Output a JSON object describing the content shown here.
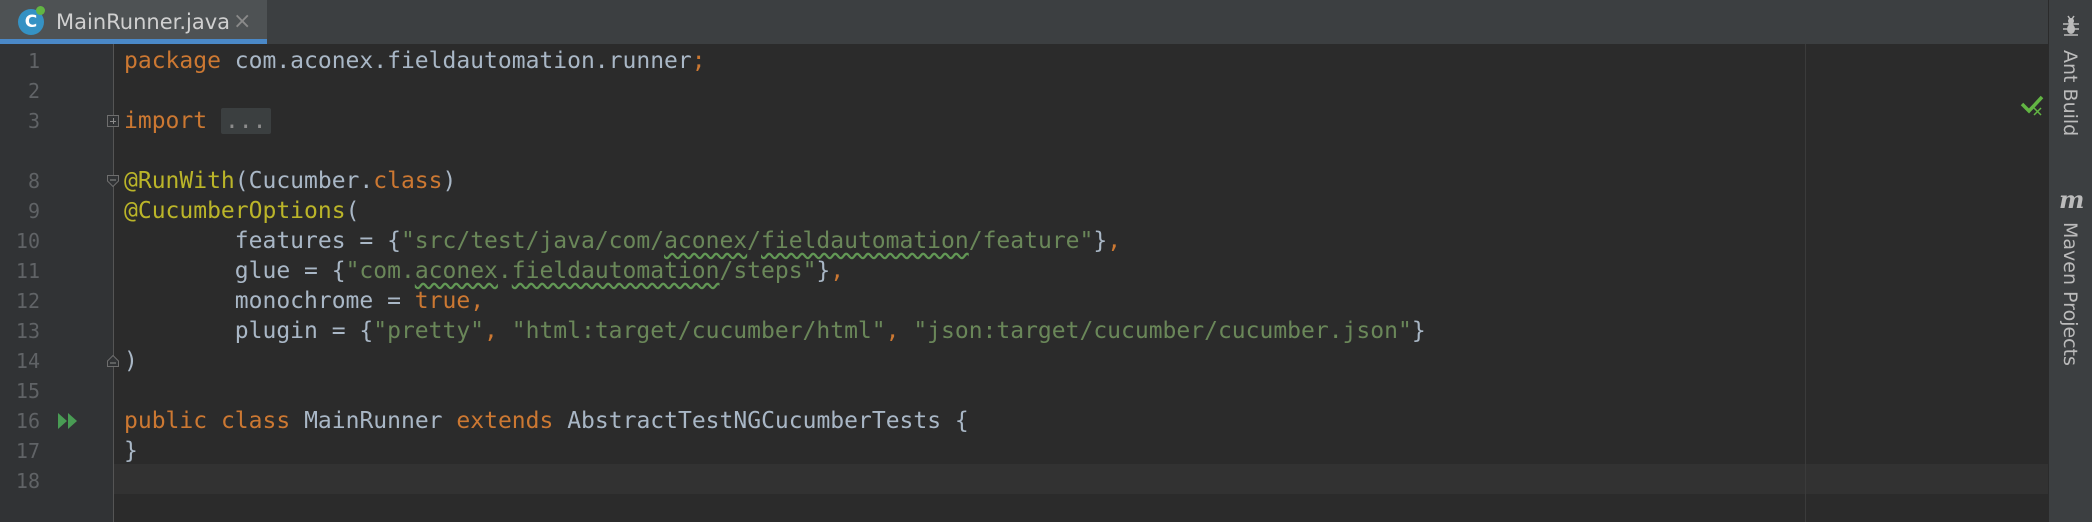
{
  "tab": {
    "icon_letter": "C",
    "title": "MainRunner.java",
    "close": "×"
  },
  "editor": {
    "line_numbers": [
      "1",
      "2",
      "3",
      "8",
      "9",
      "10",
      "11",
      "12",
      "13",
      "14",
      "15",
      "16",
      "17",
      "18"
    ],
    "lines": {
      "l1": {
        "kw": "package",
        "rest": " com.aconex.fieldautomation.runner",
        "semi": ";"
      },
      "l3": {
        "kw": "import",
        "folded": "..."
      },
      "l8": {
        "ann": "@RunWith",
        "open": "(Cucumber.",
        "kw": "class",
        "close": ")"
      },
      "l9": {
        "ann": "@CucumberOptions",
        "open": "("
      },
      "l10": {
        "name": "        features = {",
        "str_a": "\"src/test/java/com/",
        "str_b": "aconex",
        "str_c": "/",
        "str_d": "fieldautomation",
        "str_e": "/feature\"",
        "close": "}",
        "comma": ","
      },
      "l11": {
        "name": "        glue = {",
        "str_a": "\"com.",
        "str_b": "aconex",
        "str_c": ".",
        "str_d": "fieldautomation",
        "str_e": "/steps\"",
        "close": "}",
        "comma": ","
      },
      "l12": {
        "name": "        monochrome = ",
        "kw": "true",
        "comma": ","
      },
      "l13": {
        "name": "        plugin = {",
        "s1": "\"pretty\"",
        "c1": ", ",
        "s2": "\"html:target/cucumber/html\"",
        "c2": ", ",
        "s3": "\"json:target/cucumber/cucumber.json\"",
        "close": "}"
      },
      "l14": {
        "text": ")"
      },
      "l16": {
        "kw1": "public",
        "kw2": "class",
        "name": "MainRunner",
        "kw3": "extends",
        "rest": "AbstractTestNGCucumberTests {"
      },
      "l17": {
        "text": "}"
      }
    }
  },
  "sidebar": {
    "ant_label": "Ant Build",
    "maven_letter": "m",
    "maven_label": "Maven Projects"
  },
  "colors": {
    "background": "#2b2b2b",
    "keyword": "#cc7832",
    "annotation": "#bbb529",
    "string": "#6a8759",
    "field": "#9876aa",
    "text": "#a9b7c6",
    "tab_accent": "#4a88c7"
  },
  "icons": {
    "file": "java-class-icon",
    "run": "run-gutter-icon",
    "inspection": "inspection-ok-icon",
    "ant": "ant-icon",
    "maven": "maven-icon"
  }
}
